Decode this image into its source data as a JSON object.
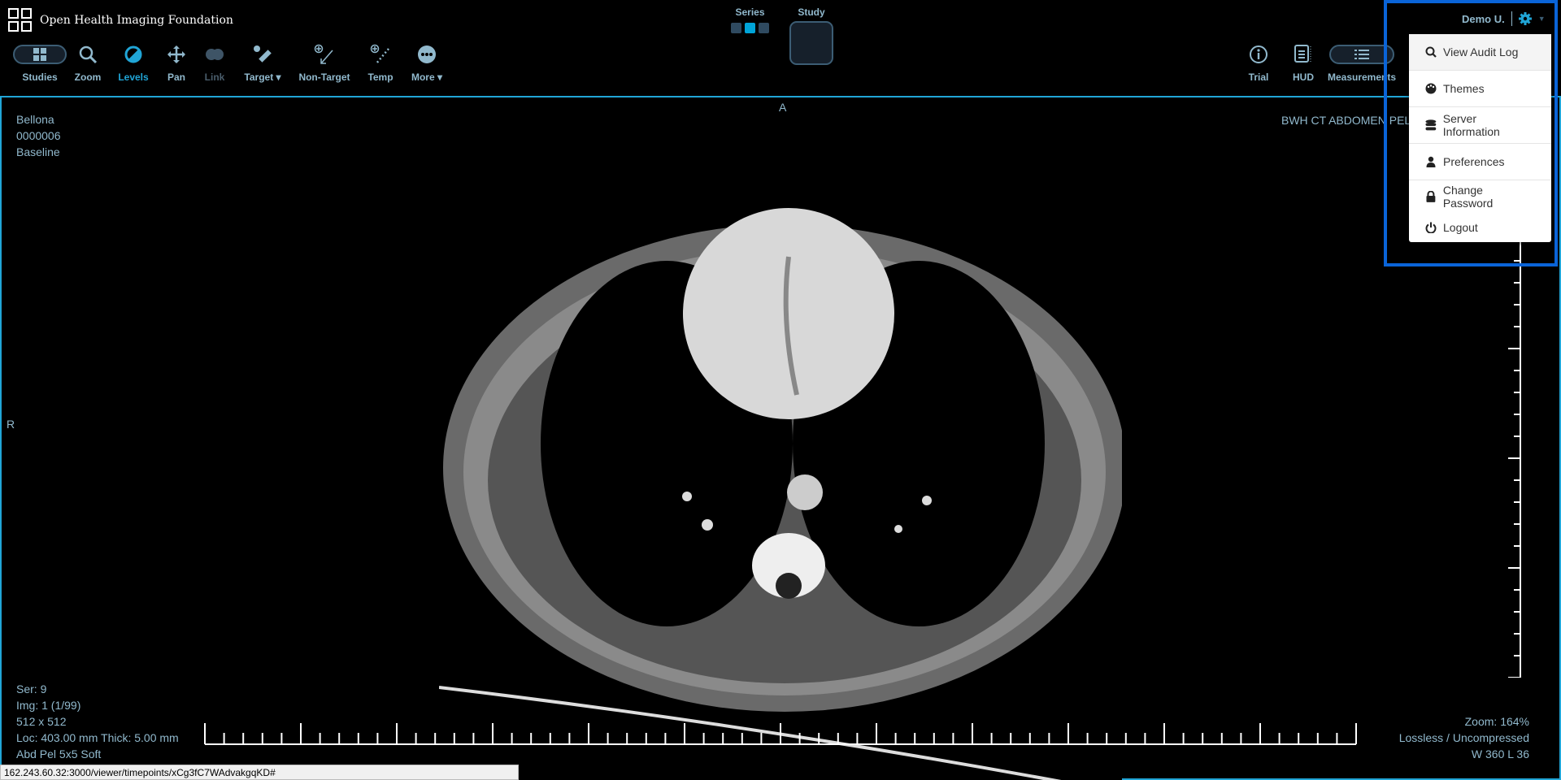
{
  "app": {
    "title": "Open Health Imaging Foundation"
  },
  "toolbar": {
    "left": [
      {
        "label": "Studies",
        "icon": "grid-icon"
      },
      {
        "label": "Zoom",
        "icon": "search-icon"
      },
      {
        "label": "Levels",
        "icon": "contrast-icon",
        "active": true
      },
      {
        "label": "Pan",
        "icon": "move-arrows-icon"
      },
      {
        "label": "Link",
        "icon": "link-circles-icon",
        "disabled": true
      },
      {
        "label": "Target ▾",
        "icon": "ruler-target-icon"
      },
      {
        "label": "Non-Target",
        "icon": "arrow-target-icon"
      },
      {
        "label": "Temp",
        "icon": "dotted-line-icon"
      },
      {
        "label": "More ▾",
        "icon": "ellipsis-circle-icon"
      }
    ],
    "right": [
      {
        "label": "Trial",
        "icon": "info-icon"
      },
      {
        "label": "HUD",
        "icon": "hud-icon"
      },
      {
        "label": "Measurements",
        "icon": "list-icon"
      }
    ]
  },
  "layout": {
    "series_label": "Series",
    "study_label": "Study"
  },
  "user": {
    "name": "Demo U.",
    "menu_icon": "gear-icon"
  },
  "user_menu": [
    {
      "label": "View Audit Log",
      "icon": "search-icon"
    },
    {
      "label": "Themes",
      "icon": "palette-icon"
    },
    {
      "label": "Server Information",
      "icon": "database-icon"
    },
    {
      "label": "Preferences",
      "icon": "user-icon"
    },
    {
      "label": "Change Password",
      "icon": "lock-icon"
    },
    {
      "label": "Logout",
      "icon": "power-icon"
    }
  ],
  "viewport": {
    "orientation_top": "A",
    "orientation_left": "R",
    "top_left": [
      "Bellona",
      "0000006",
      "Baseline"
    ],
    "top_right": "BWH CT ABDOMEN PELVIS",
    "bottom_left": [
      "Ser: 9",
      "Img: 1 (1/99)",
      "512 x 512",
      "Loc: 403.00 mm Thick: 5.00 mm",
      "Abd Pel 5x5 Soft"
    ],
    "bottom_right": [
      "Zoom: 164%",
      "Lossless / Uncompressed",
      "W 360 L 36"
    ]
  },
  "status_url": "162.243.60.32:3000/viewer/timepoints/xCg3fC7WAdvakgqKD#",
  "colors": {
    "accent": "#20a5d6",
    "text": "#91b9cd",
    "highlight": "#0a64d8"
  }
}
